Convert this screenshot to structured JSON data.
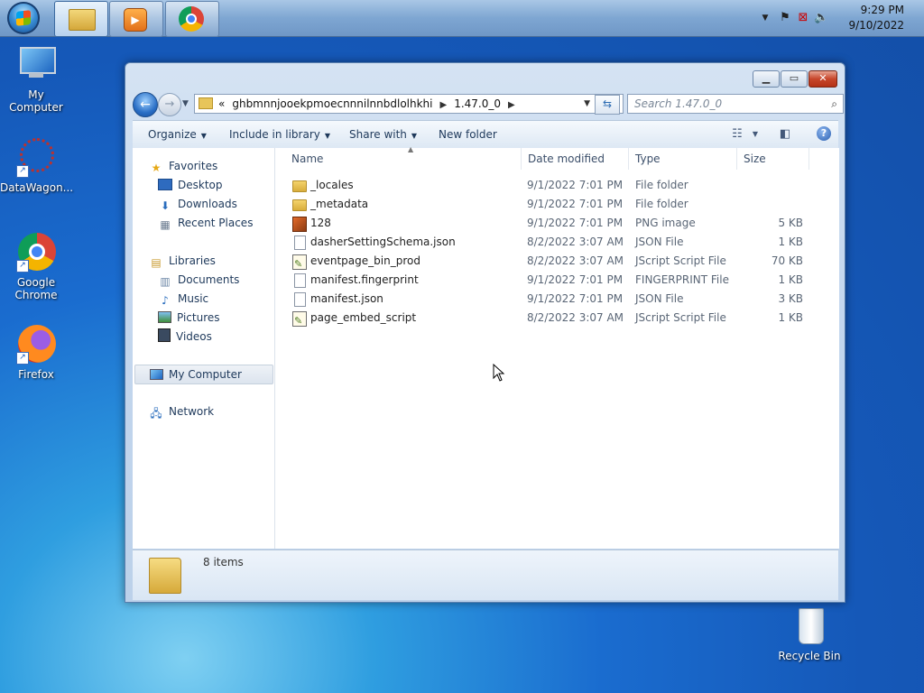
{
  "taskbar": {
    "start_label": "",
    "buttons": [
      "Windows Explorer",
      "Windows Media Player",
      "Google Chrome"
    ],
    "time": "9:29 PM",
    "date": "9/10/2022",
    "tray_icons": [
      "show-hidden-icons-arrow",
      "action-center-flag-icon",
      "network-icon",
      "volume-icon"
    ]
  },
  "desktop": {
    "icons": [
      {
        "label": "My Computer",
        "icon": "computer-icon"
      },
      {
        "label": "DataWagon...",
        "icon": "datawagon-icon"
      },
      {
        "label": "Google Chrome",
        "icon": "chrome-icon"
      },
      {
        "label": "Firefox",
        "icon": "firefox-icon"
      },
      {
        "label": "Recycle Bin",
        "icon": "recycle-bin-icon"
      }
    ]
  },
  "window": {
    "address": {
      "overflow_marker": "«",
      "segments": [
        "ghbmnnjooekpmoecnnnilnnbdlolhkhi",
        "1.47.0_0"
      ]
    },
    "search_placeholder": "Search 1.47.0_0",
    "toolbar": {
      "organize": "Organize",
      "include_in_library": "Include in library",
      "share_with": "Share with",
      "new_folder": "New folder"
    },
    "nav": {
      "favorites": "Favorites",
      "desktop": "Desktop",
      "downloads": "Downloads",
      "recent_places": "Recent Places",
      "libraries": "Libraries",
      "documents": "Documents",
      "music": "Music",
      "pictures": "Pictures",
      "videos": "Videos",
      "my_computer": "My Computer",
      "network": "Network"
    },
    "columns": {
      "name": "Name",
      "date": "Date modified",
      "type": "Type",
      "size": "Size"
    },
    "files": [
      {
        "name": "_locales",
        "date": "9/1/2022 7:01 PM",
        "type": "File folder",
        "size": "",
        "icon": "folder"
      },
      {
        "name": "_metadata",
        "date": "9/1/2022 7:01 PM",
        "type": "File folder",
        "size": "",
        "icon": "folder"
      },
      {
        "name": "128",
        "date": "9/1/2022 7:01 PM",
        "type": "PNG image",
        "size": "5 KB",
        "icon": "png"
      },
      {
        "name": "dasherSettingSchema.json",
        "date": "8/2/2022 3:07 AM",
        "type": "JSON File",
        "size": "1 KB",
        "icon": "doc"
      },
      {
        "name": "eventpage_bin_prod",
        "date": "8/2/2022 3:07 AM",
        "type": "JScript Script File",
        "size": "70 KB",
        "icon": "js"
      },
      {
        "name": "manifest.fingerprint",
        "date": "9/1/2022 7:01 PM",
        "type": "FINGERPRINT File",
        "size": "1 KB",
        "icon": "doc"
      },
      {
        "name": "manifest.json",
        "date": "9/1/2022 7:01 PM",
        "type": "JSON File",
        "size": "3 KB",
        "icon": "doc"
      },
      {
        "name": "page_embed_script",
        "date": "8/2/2022 3:07 AM",
        "type": "JScript Script File",
        "size": "1 KB",
        "icon": "js"
      }
    ],
    "status": "8 items"
  }
}
